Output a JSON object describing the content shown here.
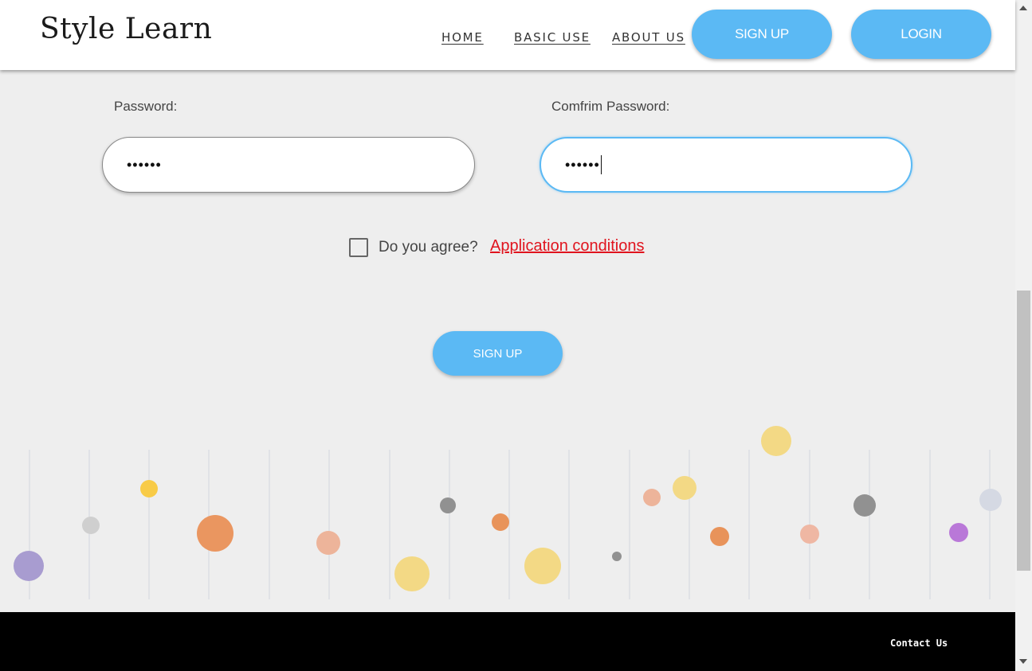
{
  "header": {
    "logo": "Style Learn",
    "nav": [
      "HOME",
      "BASIC USE",
      "ABOUT US"
    ],
    "signup_label": "SIGN UP",
    "login_label": "LOGIN"
  },
  "form": {
    "password_label": "Password:",
    "password_value": "••••••",
    "confirm_label": "Comfrim Password:",
    "confirm_value": "••••••",
    "agree_label": "Do you agree?",
    "conditions_link": "Application conditions",
    "agree_checked": false,
    "submit_label": "SIGN UP"
  },
  "footer": {
    "contact_label": "Contact Us"
  },
  "colors": {
    "accent": "#5bb9f4",
    "link_red": "#e0141e",
    "background": "#eeeeee",
    "footer": "#000000"
  }
}
